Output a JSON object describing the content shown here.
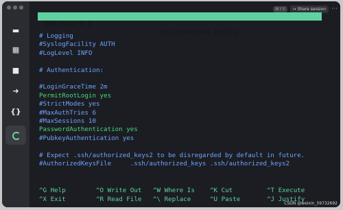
{
  "titlebar": {
    "shortcut_hint": "⌘⇧S",
    "share_label": "Share session",
    "more_label": "⋯"
  },
  "sidebar": {
    "items": [
      {
        "icon": "terminal-icon",
        "glyph": "▬"
      },
      {
        "icon": "vault-icon",
        "glyph": "▦"
      },
      {
        "icon": "folder-icon",
        "glyph": "■"
      },
      {
        "icon": "forward-icon",
        "glyph": "➜"
      },
      {
        "icon": "snippets-icon",
        "glyph": "{}"
      },
      {
        "icon": "loading-icon",
        "glyph": ""
      }
    ]
  },
  "nano": {
    "app_title": "GNU nano 6.2",
    "file_path": "/etc/ssh/sshd_config",
    "lines": [
      {
        "text": "# Logging",
        "style": "comment"
      },
      {
        "text": "#SyslogFacility AUTH",
        "style": "comment"
      },
      {
        "text": "#LogLevel INFO",
        "style": "comment"
      },
      {
        "text": "",
        "style": "comment"
      },
      {
        "text": "# Authentication:",
        "style": "comment"
      },
      {
        "text": "",
        "style": "comment"
      },
      {
        "text": "#LoginGraceTime 2m",
        "style": "comment"
      },
      {
        "text": "PermitRootLogin yes",
        "style": "active"
      },
      {
        "text": "#StrictModes yes",
        "style": "comment"
      },
      {
        "text": "#MaxAuthTries 6",
        "style": "comment"
      },
      {
        "text": "#MaxSessions 10",
        "style": "comment"
      },
      {
        "text": "PasswordAuthentication yes",
        "style": "active"
      },
      {
        "text": "#PubkeyAuthentication yes",
        "style": "comment"
      },
      {
        "text": "",
        "style": "comment"
      },
      {
        "text": "# Expect .ssh/authorized_keys2 to be disregarded by default in future.",
        "style": "comment"
      },
      {
        "text": "#AuthorizedKeysFile     .ssh/authorized_keys .ssh/authorized_keys2",
        "style": "comment"
      }
    ],
    "shortcuts_row1": [
      {
        "key": "^G",
        "label": "Help"
      },
      {
        "key": "^O",
        "label": "Write Out"
      },
      {
        "key": "^W",
        "label": "Where Is"
      },
      {
        "key": "^K",
        "label": "Cut"
      },
      {
        "key": "^T",
        "label": "Execute"
      }
    ],
    "shortcuts_row2": [
      {
        "key": "^X",
        "label": "Exit"
      },
      {
        "key": "^R",
        "label": "Read File"
      },
      {
        "key": "^\\",
        "label": "Replace"
      },
      {
        "key": "^U",
        "label": "Paste"
      },
      {
        "key": "^J",
        "label": "Justify"
      }
    ]
  },
  "watermark": "CSDN @weixin_59732692",
  "colors": {
    "header_bg": "#5fd1a0",
    "comment": "#6fa3ff",
    "active": "#49d67f"
  }
}
